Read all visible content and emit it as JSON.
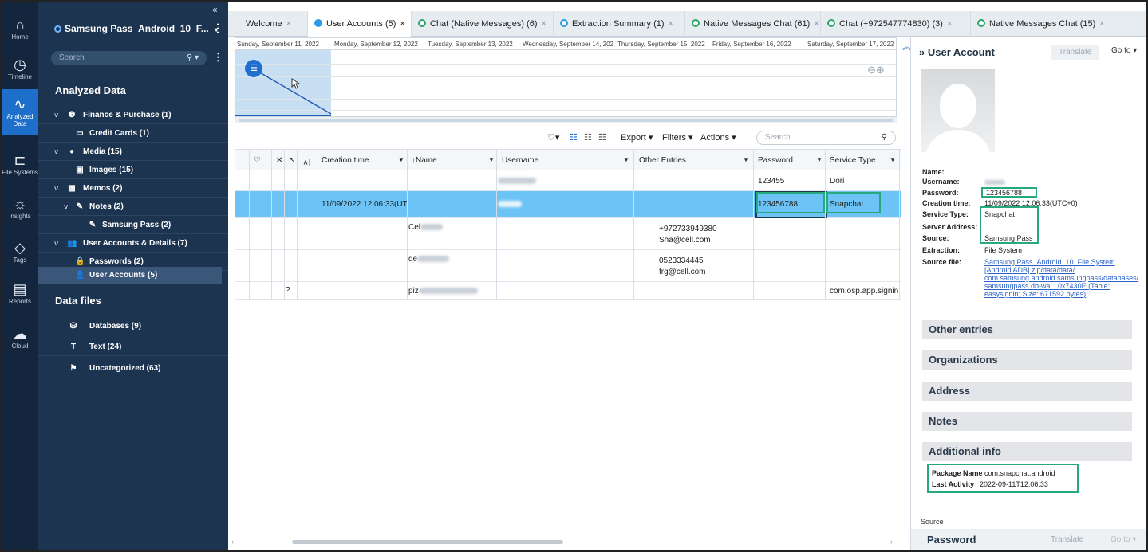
{
  "rail": [
    {
      "label": "Home",
      "icon": "home-icon"
    },
    {
      "label": "Timeline",
      "icon": "clock-icon"
    },
    {
      "label": "Analyzed Data",
      "icon": "pulse-icon"
    },
    {
      "label": "File Systems",
      "icon": "tree-icon"
    },
    {
      "label": "Insights",
      "icon": "bulb-icon"
    },
    {
      "label": "Tags",
      "icon": "tag-icon"
    },
    {
      "label": "Reports",
      "icon": "report-icon"
    },
    {
      "label": "Cloud",
      "icon": "cloud-icon"
    }
  ],
  "sidebar": {
    "case_title": "Samsung Pass_Android_10_F...",
    "search_placeholder": "Search",
    "analyzed_title": "Analyzed Data",
    "data_files_title": "Data files",
    "items": [
      {
        "label": "Finance & Purchase (1)"
      },
      {
        "label": "Credit Cards (1)"
      },
      {
        "label": "Media (15)"
      },
      {
        "label": "Images (15)"
      },
      {
        "label": "Memos (2)"
      },
      {
        "label": "Notes (2)"
      },
      {
        "label": "Samsung Pass (2)"
      },
      {
        "label": "User Accounts & Details (7)"
      },
      {
        "label": "Passwords (2)"
      },
      {
        "label": "User Accounts (5)"
      }
    ],
    "files": [
      {
        "label": "Databases (9)"
      },
      {
        "label": "Text (24)"
      },
      {
        "label": "Uncategorized (63)"
      }
    ]
  },
  "tabs": [
    {
      "label": "Welcome"
    },
    {
      "label": "User Accounts (5)"
    },
    {
      "label": "Chat (Native Messages) (6)"
    },
    {
      "label": "Extraction Summary (1)"
    },
    {
      "label": "Native Messages Chat (61)"
    },
    {
      "label": "Chat (+972547774830) (3)"
    },
    {
      "label": "Native Messages Chat (15)"
    }
  ],
  "timeline": {
    "dates": [
      "Sunday, September 11, 2022",
      "Monday, September 12, 2022",
      "Tuesday, September 13, 2022",
      "Wednesday, September 14, 202",
      "Thursday, September 15, 2022",
      "Friday, September 16, 2022",
      "Saturday, September 17, 2022"
    ]
  },
  "toolbar": {
    "export": "Export",
    "filters": "Filters",
    "actions": "Actions",
    "search_placeholder": "Search"
  },
  "table": {
    "headers": [
      "Creation time",
      "Name",
      "Username",
      "Other Entries",
      "Password",
      "Service Type"
    ],
    "rows": [
      {
        "creation": "",
        "name": "",
        "other1": "",
        "other2": "",
        "password": "123455",
        "service": "Dori",
        "flag": ""
      },
      {
        "creation": "11/09/2022 12:06:33(UT...",
        "name": "",
        "other1": "",
        "other2": "",
        "password": "123456788",
        "service": "Snapchat",
        "flag": ""
      },
      {
        "creation": "",
        "name": "Cel",
        "other1": "+972733949380",
        "other2": "Sha@cell.com",
        "password": "",
        "service": "",
        "flag": ""
      },
      {
        "creation": "",
        "name": "de",
        "other1": "0523334445",
        "other2": "frg@cell.com",
        "password": "",
        "service": "",
        "flag": ""
      },
      {
        "creation": "",
        "name": "piz",
        "other1": "",
        "other2": "",
        "password": "",
        "service": "com.osp.app.signin",
        "flag": "?"
      }
    ]
  },
  "detail": {
    "title": "User Account",
    "translate": "Translate",
    "goto": "Go to",
    "fields": {
      "name_k": "Name:",
      "username_k": "Username:",
      "password_k": "Password:",
      "password_v": "123456788",
      "creation_k": "Creation time:",
      "creation_v": "11/09/2022 12:06:33(UTC+0)",
      "service_k": "Service Type:",
      "service_v": "Snapchat",
      "server_k": "Server Address:",
      "source_k": "Source:",
      "source_v": "Samsung Pass",
      "extraction_k": "Extraction:",
      "extraction_v": "File System",
      "sourcefile_k": "Source file:",
      "sourcefile_v": "Samsung Pass_Android_10_File System [Android ADB].zip/data/data/ com.samsung.android.samsungpass/databases/ samsungpass.db-wal : 0x7430E (Table: easysignin; Size: 671592 bytes)"
    },
    "sections": [
      "Other entries",
      "Organizations",
      "Address",
      "Notes",
      "Additional info"
    ],
    "additional": {
      "package_k": "Package Name",
      "package_v": "com.snapchat.android",
      "activity_k": "Last Activity",
      "activity_v": "2022-09-11T12:06:33"
    },
    "source_label": "Source",
    "password_title": "Password"
  }
}
